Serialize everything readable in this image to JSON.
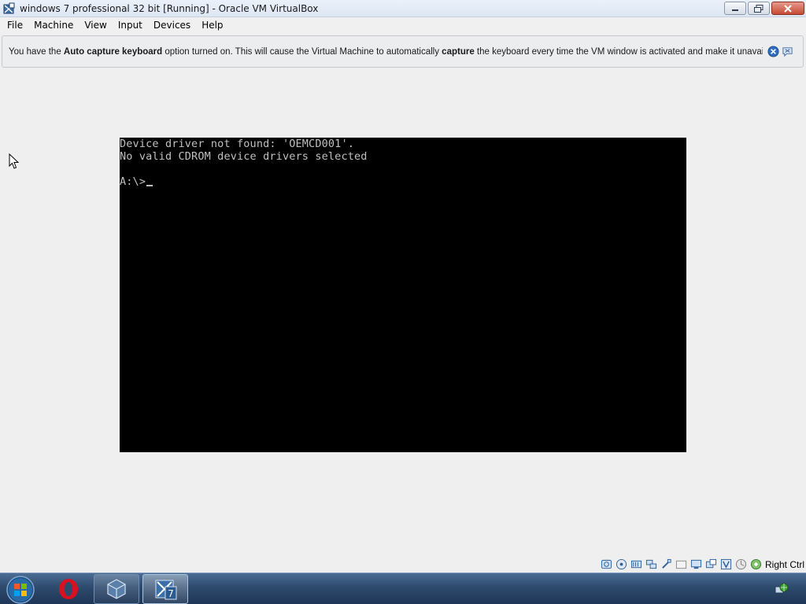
{
  "window": {
    "title": "windows 7 professional 32 bit [Running] - Oracle VM VirtualBox",
    "app_icon": "virtualbox-icon"
  },
  "menu": {
    "items": [
      {
        "label": "File"
      },
      {
        "label": "Machine"
      },
      {
        "label": "View"
      },
      {
        "label": "Input"
      },
      {
        "label": "Devices"
      },
      {
        "label": "Help"
      }
    ]
  },
  "notification": {
    "text_1": "You have the ",
    "bold_1": "Auto capture keyboard",
    "text_2": " option turned on. This will cause the Virtual Machine to automatically ",
    "bold_2": "capture",
    "text_3": " the keyboard every time the VM window is activated and make it unavailable to",
    "close_icon": "close-circle-icon",
    "dont_show_icon": "speech-bubble-icon"
  },
  "console": {
    "lines": [
      "Device driver not found: 'OEMCD001'.",
      "No valid CDROM device drivers selected",
      "",
      "A:\\>"
    ]
  },
  "statusbar": {
    "icons": [
      "hard-disk-icon",
      "optical-drive-icon",
      "audio-icon",
      "network-icon",
      "usb-icon",
      "shared-folders-icon",
      "display-icon",
      "video-capture-icon",
      "virtualization-icon",
      "mouse-integration-icon",
      "keyboard-capture-icon"
    ],
    "host_key": "Right Ctrl"
  },
  "taskbar": {
    "items": [
      "start-orb",
      "opera-icon",
      "virtualbox-icon",
      "windows7-vm-icon"
    ],
    "tray_icon": "network-globe-icon"
  },
  "colors": {
    "console_bg": "#000000",
    "console_fg": "#c0c0c0",
    "taskbar": "#2e4a6d"
  }
}
